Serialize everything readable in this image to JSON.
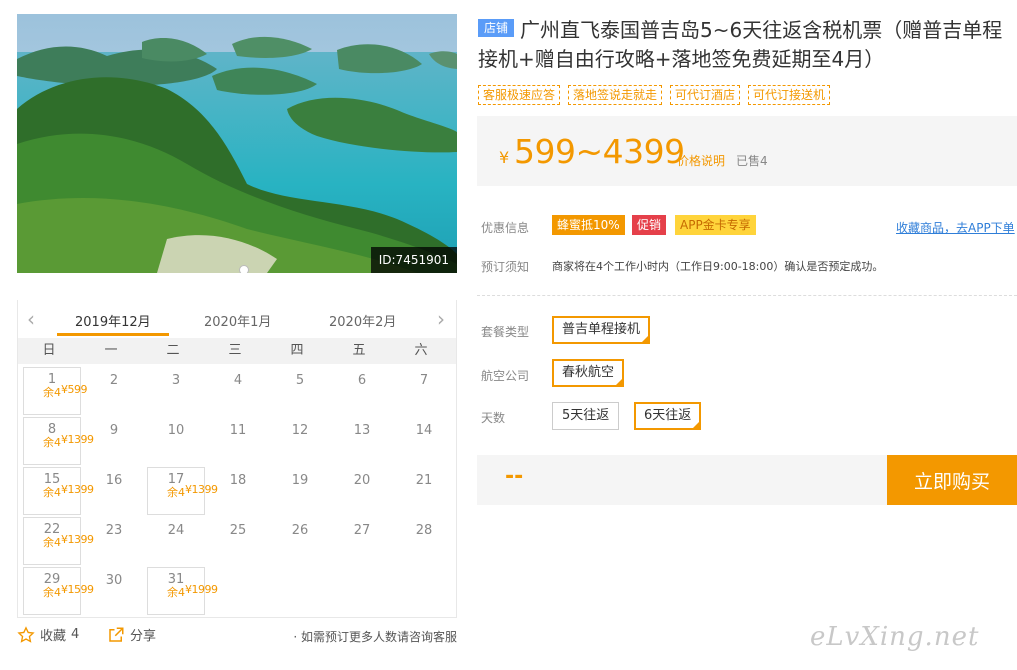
{
  "photo": {
    "id_label": "ID:7451901"
  },
  "calendar": {
    "months": [
      "2019年12月",
      "2020年1月",
      "2020年2月"
    ],
    "prev_icon": "chevron-left-icon",
    "next_icon": "chevron-right-icon",
    "weekdays": [
      "日",
      "一",
      "二",
      "三",
      "四",
      "五",
      "六"
    ],
    "days": [
      {
        "d": "1",
        "price": "¥599",
        "stock": "余4"
      },
      {
        "d": "2"
      },
      {
        "d": "3"
      },
      {
        "d": "4"
      },
      {
        "d": "5"
      },
      {
        "d": "6"
      },
      {
        "d": "7"
      },
      {
        "d": "8",
        "price": "¥1399",
        "stock": "余4"
      },
      {
        "d": "9"
      },
      {
        "d": "10"
      },
      {
        "d": "11"
      },
      {
        "d": "12"
      },
      {
        "d": "13"
      },
      {
        "d": "14"
      },
      {
        "d": "15",
        "price": "¥1399",
        "stock": "余4"
      },
      {
        "d": "16"
      },
      {
        "d": "17",
        "price": "¥1399",
        "stock": "余4"
      },
      {
        "d": "18"
      },
      {
        "d": "19"
      },
      {
        "d": "20"
      },
      {
        "d": "21"
      },
      {
        "d": "22",
        "price": "¥1399",
        "stock": "余4"
      },
      {
        "d": "23"
      },
      {
        "d": "24"
      },
      {
        "d": "25"
      },
      {
        "d": "26"
      },
      {
        "d": "27"
      },
      {
        "d": "28"
      },
      {
        "d": "29",
        "price": "¥1599",
        "stock": "余4"
      },
      {
        "d": "30"
      },
      {
        "d": "31",
        "price": "¥1999",
        "stock": "余4"
      }
    ]
  },
  "bottom": {
    "fav_icon": "star-icon",
    "fav_label": "收藏",
    "fav_count": "4",
    "share_icon": "share-icon",
    "share_label": "分享",
    "consult": "· 如需预订更多人数请咨询客服"
  },
  "product": {
    "shop_tag": "店铺",
    "title": "广州直飞泰国普吉岛5~6天往返含税机票（赠普吉单程接机+赠自由行攻略+落地签免费延期至4月）",
    "tags": [
      "客服极速应答",
      "落地签说走就走",
      "可代订酒店",
      "可代订接送机"
    ],
    "currency": "¥",
    "price": "599~4399",
    "price_note": "价格说明",
    "sold": "已售4"
  },
  "promo": {
    "label": "优惠信息",
    "badges": [
      "蜂蜜抵10%",
      "促销",
      "APP金卡专享"
    ],
    "fav_app": "收藏商品，去APP下单"
  },
  "booking": {
    "label": "预订须知",
    "notice": "商家将在4个工作小时内（工作日9:00-18:00）确认是否预定成功。"
  },
  "options": {
    "package_label": "套餐类型",
    "package": "普吉单程接机",
    "airline_label": "航空公司",
    "airline": "春秋航空",
    "days_label": "天数",
    "days": [
      "5天往返",
      "6天往返"
    ],
    "days_selected": 1
  },
  "buy": {
    "total": "--",
    "button": "立即购买"
  },
  "watermark": "eLvXing.net",
  "colors": {
    "accent": "#f39800",
    "link": "#2f7ed8",
    "shop_tag": "#5a9cf8",
    "promo_red": "#e5404a"
  }
}
